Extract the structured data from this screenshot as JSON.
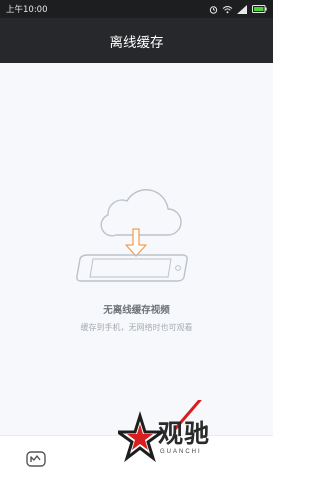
{
  "status_bar": {
    "time": "上午10:00",
    "icons": [
      "alarm-icon",
      "wifi-icon",
      "signal-icon",
      "battery-icon"
    ]
  },
  "header": {
    "title": "离线缓存"
  },
  "empty_state": {
    "icon": "cloud-download-to-phone-icon",
    "title": "无离线缓存视频",
    "subtitle": "缓存到手机，无网络时也可观看"
  },
  "bottom_bar": {
    "icon": "video-tab-icon"
  },
  "watermark": {
    "text": "观驰",
    "subtext": "GUANCHI"
  },
  "colors": {
    "header_bg": "#27282b",
    "status_bg": "#1d1e20",
    "content_bg": "#f6f8fb",
    "accent_orange": "#f0a15a",
    "line_gray": "#bcc2c9",
    "battery_green": "#4cd137"
  }
}
